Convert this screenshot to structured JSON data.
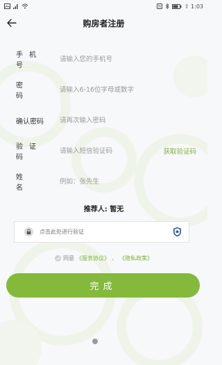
{
  "status_bar": {
    "left_icons": [
      "image-icon",
      "signal-icon",
      "wifi-icon"
    ],
    "right_text": "⇧ 1:03",
    "right_icons": [
      "nfc-icon",
      "bluetooth-icon",
      "battery-icon"
    ]
  },
  "nav": {
    "title": "购房者注册",
    "back_icon": "arrow-left-icon"
  },
  "form": {
    "phone": {
      "label": "手机号",
      "placeholder": "请输入您的手机号"
    },
    "password": {
      "label": "密码",
      "placeholder": "请输入6-16位字母或数字"
    },
    "confirm_password": {
      "label": "确认密码",
      "placeholder": "请再次输入密码"
    },
    "code": {
      "label": "验证码",
      "placeholder": "请输入短信验证码",
      "get_code": "获取验证码"
    },
    "name": {
      "label": "姓名",
      "placeholder": "例如：张先生"
    }
  },
  "referrer": "推荐人: 暂无",
  "verify": {
    "text": "点击此处进行验证"
  },
  "agreement": {
    "prefix": "同意",
    "service": "《服务协议》",
    "separator": "、",
    "privacy": "《隐私政策》"
  },
  "submit": {
    "label": "完成"
  },
  "colors": {
    "accent": "#84b93c",
    "link": "#7fb043",
    "background": "#f7f8f9"
  }
}
